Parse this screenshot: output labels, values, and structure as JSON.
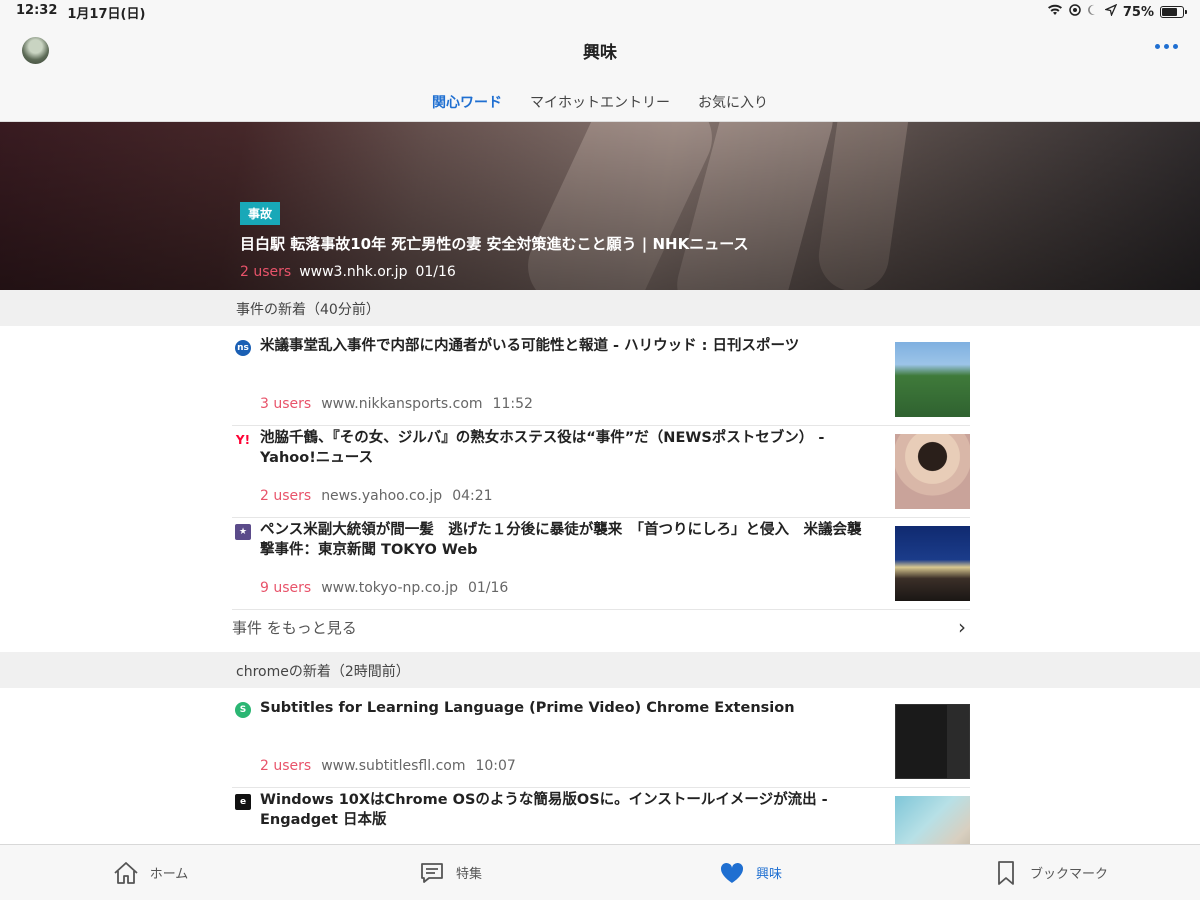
{
  "status": {
    "time": "12:32",
    "date": "1月17日(日)",
    "battery": "75%",
    "battery_level": 0.75
  },
  "header": {
    "title": "興味"
  },
  "tabs": [
    {
      "label": "関心ワード",
      "active": true
    },
    {
      "label": "マイホットエントリー",
      "active": false
    },
    {
      "label": "お気に入り",
      "active": false
    }
  ],
  "hero": {
    "badge": "事故",
    "title": "目白駅 転落事故10年 死亡男性の妻 安全対策進むこと願う | NHKニュース",
    "users": "2 users",
    "domain": "www3.nhk.or.jp",
    "date": "01/16"
  },
  "sections": [
    {
      "header": "事件の新着（40分前）",
      "articles": [
        {
          "icon": "nikkansports-icon",
          "icon_text": "ns",
          "icon_color": "#1a5fb4",
          "title": "米議事堂乱入事件で内部に内通者がいる可能性と報道 - ハリウッド : 日刊スポーツ",
          "users": "3 users",
          "domain": "www.nikkansports.com",
          "time": "11:52"
        },
        {
          "icon": "yahoo-icon",
          "icon_text": "Y!",
          "icon_color": "#ff0033",
          "title": "池脇千鶴、『その女、ジルバ』の熟女ホステス役は“事件”だ（NEWSポストセブン） - Yahoo!ニュース",
          "users": "2 users",
          "domain": "news.yahoo.co.jp",
          "time": "04:21"
        },
        {
          "icon": "tokyo-np-icon",
          "icon_text": "★",
          "icon_color": "#5b4b8a",
          "title": "ペンス米副大統領が間一髪　逃げた１分後に暴徒が襲来　「首つりにしろ」と侵入　米議会襲撃事件：東京新聞 TOKYO Web",
          "users": "9 users",
          "domain": "www.tokyo-np.co.jp",
          "time": "01/16"
        }
      ],
      "more_label": "事件 をもっと見る"
    },
    {
      "header": "chromeの新着（2時間前）",
      "articles": [
        {
          "icon": "subtitles-icon",
          "icon_text": "S",
          "icon_color": "#2bb673",
          "title": "Subtitles for Learning Language (Prime Video) Chrome Extension",
          "users": "2 users",
          "domain": "www.subtitlesfll.com",
          "time": "10:07"
        },
        {
          "icon": "engadget-icon",
          "icon_text": "e",
          "icon_color": "#111111",
          "title": "Windows 10XはChrome OSのような簡易版OSに。インストールイメージが流出 - Engadget 日本版",
          "users": "",
          "domain": "",
          "time": ""
        }
      ]
    }
  ],
  "tabbar": [
    {
      "label": "ホーム",
      "icon": "home-icon",
      "active": false
    },
    {
      "label": "特集",
      "icon": "chat-icon",
      "active": false
    },
    {
      "label": "興味",
      "icon": "heart-icon",
      "active": true
    },
    {
      "label": "ブックマーク",
      "icon": "bookmark-icon",
      "active": false
    }
  ],
  "colors": {
    "accent": "#1f6fd1",
    "users": "#e8536a",
    "badge": "#18a8b8"
  }
}
